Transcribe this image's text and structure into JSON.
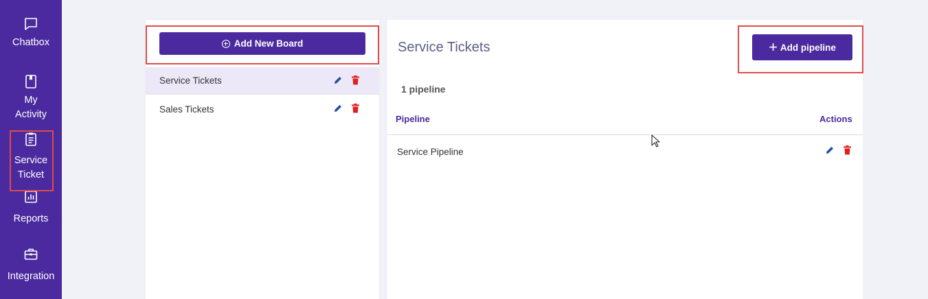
{
  "sidebar": {
    "items": [
      {
        "label": "Chatbox",
        "icon": "chat-icon"
      },
      {
        "label": "My Activity",
        "icon": "notebook-icon"
      },
      {
        "label": "Service Ticket",
        "icon": "clipboard-icon"
      },
      {
        "label": "Reports",
        "icon": "bar-chart-icon"
      },
      {
        "label": "Integration",
        "icon": "toolbox-icon"
      }
    ]
  },
  "boards": {
    "add_label": "Add New Board",
    "items": [
      {
        "name": "Service Tickets",
        "active": true
      },
      {
        "name": "Sales Tickets",
        "active": false
      }
    ]
  },
  "main": {
    "title": "Service Tickets",
    "add_pipeline_label": "Add pipeline",
    "count_label": "1 pipeline",
    "columns": [
      "Pipeline",
      "Actions"
    ],
    "rows": [
      {
        "pipeline": "Service Pipeline"
      }
    ]
  },
  "colors": {
    "brand": "#4a2a9e",
    "edit": "#1e4fa0",
    "delete": "#e02020",
    "highlight": "#e14a4a"
  }
}
